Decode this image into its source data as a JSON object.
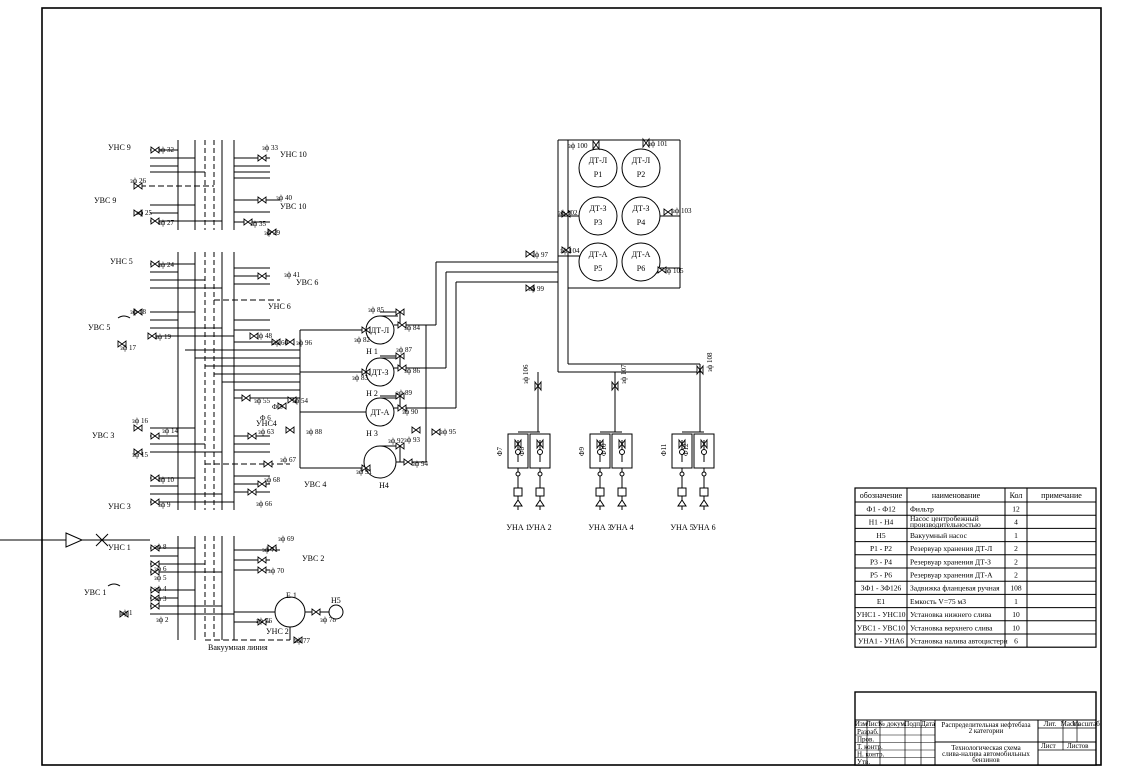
{
  "tanks": [
    {
      "code": "ДТ-Л",
      "id": "Р1"
    },
    {
      "code": "ДТ-Л",
      "id": "Р2"
    },
    {
      "code": "ДТ-З",
      "id": "Р3"
    },
    {
      "code": "ДТ-З",
      "id": "Р4"
    },
    {
      "code": "ДТ-А",
      "id": "Р5"
    },
    {
      "code": "ДТ-А",
      "id": "Р6"
    }
  ],
  "pumps": [
    {
      "code": "ДТ-Л",
      "id": "Н 1"
    },
    {
      "code": "ДТ-З",
      "id": "Н 2"
    },
    {
      "code": "ДТ-А",
      "id": "Н 3"
    },
    {
      "code": "",
      "id": "Н4"
    }
  ],
  "tank_valves": [
    "зф 100",
    "зф 101",
    "зф 102",
    "зф 103",
    "зф 104",
    "зф 105",
    "зф 97",
    "зф 99"
  ],
  "pump_valves": [
    "зф 82",
    "зф 83",
    "зф 84",
    "зф 85",
    "зф 86",
    "зф 87",
    "зф 88",
    "зф 89",
    "зф 90",
    "зф 91",
    "зф 92",
    "зф 93",
    "зф 94",
    "зф 95",
    "зф 96",
    "зф 55",
    "зф 54",
    "зф 60",
    "Ф 5",
    "Ф 6"
  ],
  "left_labels": [
    "УНС 9",
    "УВС 9",
    "УНС 10",
    "УВС 10",
    "УНС 5",
    "УВС 5",
    "УНС 6",
    "УВС 6",
    "УВС 3",
    "УНС 3",
    "УНС4",
    "УВС 4",
    "УНС 1",
    "УВС 1",
    "УВС 2",
    "УНС 2"
  ],
  "left_valves": [
    "зф 32",
    "зф 26",
    "зф 25",
    "зф 27",
    "зф 33",
    "зф 40",
    "зф 35",
    "зф 39",
    "зф 24",
    "зф 41",
    "зф 18",
    "зф 19",
    "зф 17",
    "зф 48",
    "зф 16",
    "зф 14",
    "зф 15",
    "зф 10",
    "зф 9",
    "зф 63",
    "зф 67",
    "зф 68",
    "зф 66",
    "зф 8",
    "зф 6",
    "зф 5",
    "зф 4",
    "зф 3",
    "зф 2",
    "зф 1",
    "зф 69",
    "зф 71",
    "зф 70",
    "зф 76",
    "зф 77",
    "зф 78"
  ],
  "vacuum": {
    "line_label": "Вакуумная линия",
    "tank": "Е 1",
    "pump": "Н5"
  },
  "filling": {
    "valves": [
      "зф 106",
      "зф 107",
      "зф 108"
    ],
    "filters": [
      "Ф7",
      "Ф8",
      "Ф9",
      "Ф10",
      "Ф11",
      "Ф12"
    ],
    "units": [
      "УНА 1",
      "УНА 2",
      "УНА 3",
      "УНА 4",
      "УНА 5",
      "УНА 6"
    ]
  },
  "legend": {
    "headers": [
      "обозначение",
      "наименование",
      "Кол",
      "примечание"
    ],
    "rows": [
      [
        "Ф1 - Ф12",
        "Фильтр",
        "12",
        ""
      ],
      [
        "Н1 - Н4",
        "Насос центробежный производительностью",
        "4",
        ""
      ],
      [
        "Н5",
        "Вакуумный насос",
        "1",
        ""
      ],
      [
        "Р1 - Р2",
        "Резервуар хранения ДТ-Л",
        "2",
        ""
      ],
      [
        "Р3 - Р4",
        "Резервуар хранения ДТ-З",
        "2",
        ""
      ],
      [
        "Р5 - Р6",
        "Резервуар хранения ДТ-А",
        "2",
        ""
      ],
      [
        "ЗФ1 - ЗФ126",
        "Задвижка фланцевая ручная",
        "108",
        ""
      ],
      [
        "Е1",
        "Емкость V=75 м3",
        "1",
        ""
      ],
      [
        "УНС1 - УНС10",
        "Установка нижнего слива",
        "10",
        ""
      ],
      [
        "УВС1 - УВС10",
        "Установка верхнего слива",
        "10",
        ""
      ],
      [
        "УНА1 - УНА6",
        "Установка налива автоцистерн",
        "6",
        ""
      ]
    ]
  },
  "title_block": {
    "cols": [
      "Изм",
      "Лист",
      "№ докум.",
      "Подп.",
      "Дата"
    ],
    "roles": [
      "Разраб.",
      "Пров.",
      "Т. контр.",
      "Н. контр.",
      "Утв."
    ],
    "title1": "Распределительная нефтебаза",
    "title2": "2 категории",
    "title3": "Технологическая схема",
    "title4": "слива-налива автомобильных",
    "title5": "бензинов",
    "right_heads": [
      "Лит.",
      "Масса",
      "Масштаб"
    ],
    "sheet": "Лист",
    "sheets": "Листов"
  }
}
